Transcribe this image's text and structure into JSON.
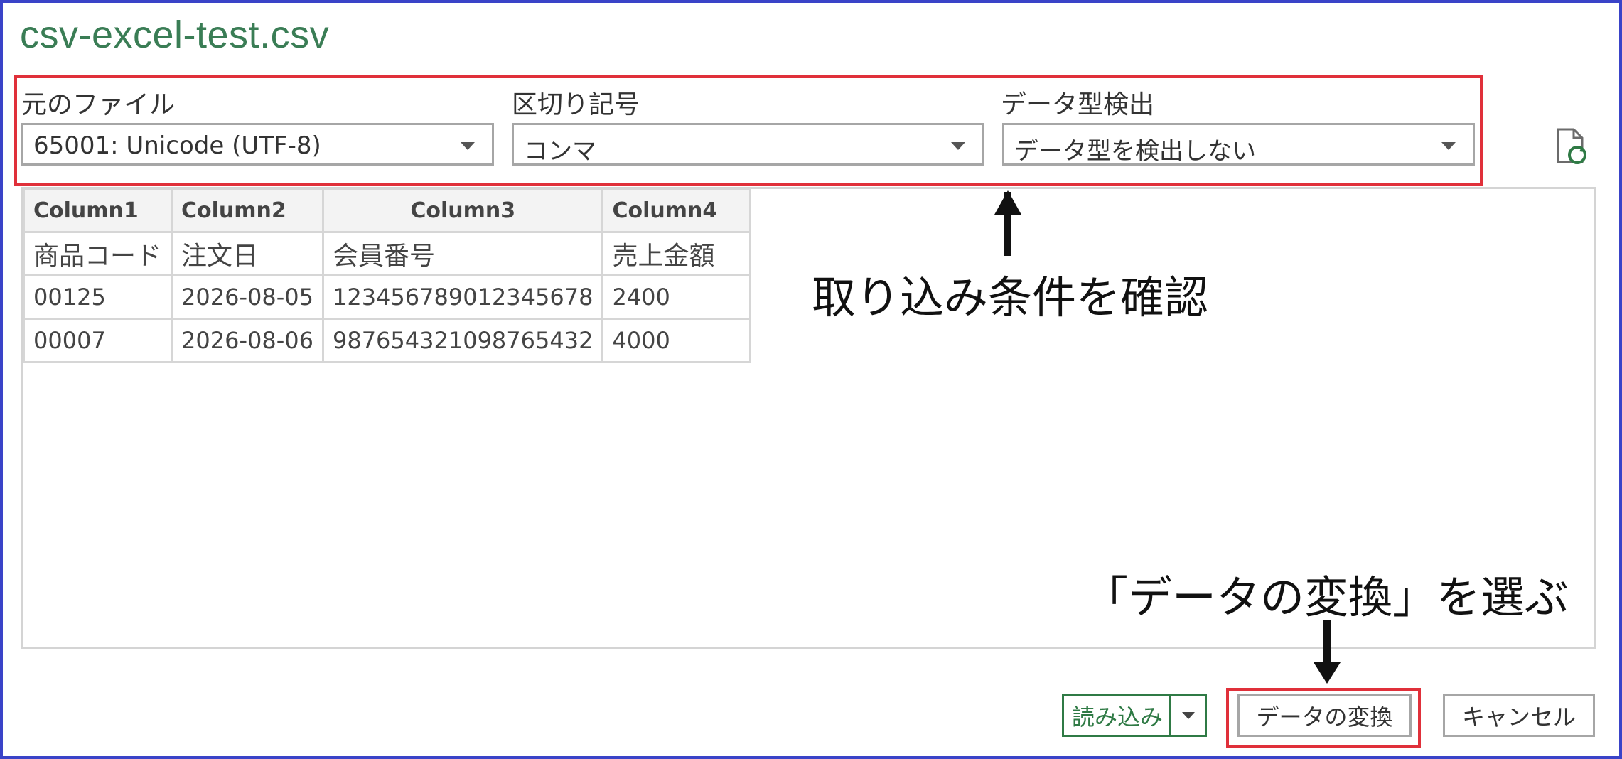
{
  "window": {
    "title": "csv-excel-test.csv"
  },
  "options": {
    "file_origin": {
      "label": "元のファイル",
      "value": "65001: Unicode (UTF-8)"
    },
    "delimiter": {
      "label": "区切り記号",
      "value": "コンマ"
    },
    "type_detection": {
      "label": "データ型検出",
      "value": "データ型を検出しない"
    }
  },
  "preview": {
    "headers": [
      "Column1",
      "Column2",
      "Column3",
      "Column4"
    ],
    "rows": [
      [
        "商品コード",
        "注文日",
        "会員番号",
        "売上金額"
      ],
      [
        "00125",
        "2026-08-05",
        "123456789012345678",
        "2400"
      ],
      [
        "00007",
        "2026-08-06",
        "987654321098765432",
        "4000"
      ]
    ]
  },
  "annotations": {
    "check_conditions": "取り込み条件を確認",
    "choose_transform": "「データの変換」を選ぶ"
  },
  "buttons": {
    "load": "読み込み",
    "transform": "データの変換",
    "cancel": "キャンセル"
  },
  "colors": {
    "frame": "#3a43c8",
    "title": "#3a7d55",
    "highlight": "#e0303a",
    "load_button": "#2f7a45"
  },
  "icons": {
    "refresh": "file-refresh-icon"
  }
}
